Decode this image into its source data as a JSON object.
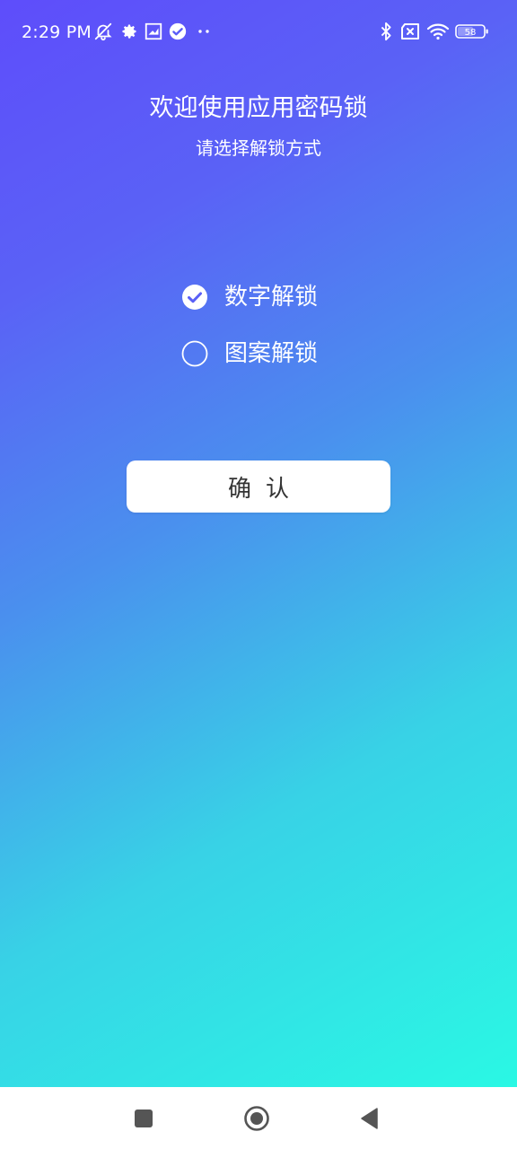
{
  "status_bar": {
    "time": "2:29 PM",
    "battery": "58",
    "icons": [
      "muted-notification-icon",
      "settings-gear-icon",
      "app-shield-icon",
      "check-badge-icon",
      "more-dots-icon",
      "bluetooth-icon",
      "no-sim-icon",
      "wifi-icon",
      "battery-icon"
    ]
  },
  "header": {
    "title": "欢迎使用应用密码锁",
    "subtitle": "请选择解锁方式"
  },
  "options": [
    {
      "label": "数字解锁",
      "selected": true
    },
    {
      "label": "图案解锁",
      "selected": false
    }
  ],
  "confirm_label": "确认",
  "nav_bar": {
    "buttons": [
      "recents-square-icon",
      "home-circle-icon",
      "back-triangle-icon"
    ]
  },
  "colors": {
    "gradient_start": "#5e4dfb",
    "gradient_end": "#2af8e4",
    "text": "#ffffff",
    "button_bg": "#ffffff",
    "button_text": "#333333",
    "nav_icon": "#555555"
  }
}
